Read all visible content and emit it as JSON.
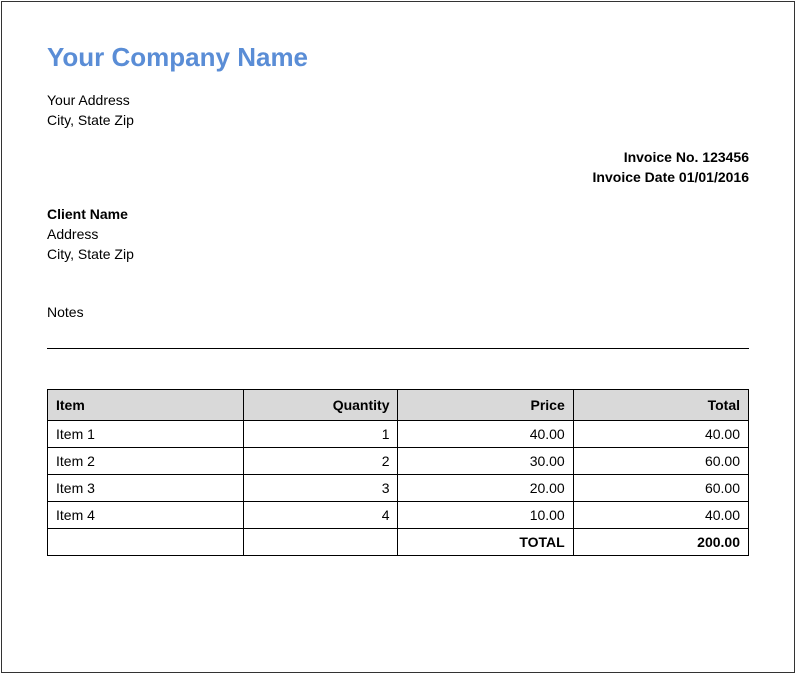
{
  "company": {
    "name": "Your Company Name",
    "address_line1": "Your Address",
    "address_line2": "City, State Zip"
  },
  "invoice": {
    "number_label": "Invoice No.",
    "number": "123456",
    "date_label": "Invoice Date",
    "date": "01/01/2016"
  },
  "client": {
    "name": "Client Name",
    "address_line1": "Address",
    "address_line2": "City, State Zip"
  },
  "notes": {
    "label": "Notes"
  },
  "table": {
    "headers": {
      "item": "Item",
      "quantity": "Quantity",
      "price": "Price",
      "total": "Total"
    },
    "rows": [
      {
        "item": "Item 1",
        "quantity": "1",
        "price": "40.00",
        "total": "40.00"
      },
      {
        "item": "Item 2",
        "quantity": "2",
        "price": "30.00",
        "total": "60.00"
      },
      {
        "item": "Item 3",
        "quantity": "3",
        "price": "20.00",
        "total": "60.00"
      },
      {
        "item": "Item 4",
        "quantity": "4",
        "price": "10.00",
        "total": "40.00"
      }
    ],
    "total_label": "TOTAL",
    "total_value": "200.00"
  }
}
